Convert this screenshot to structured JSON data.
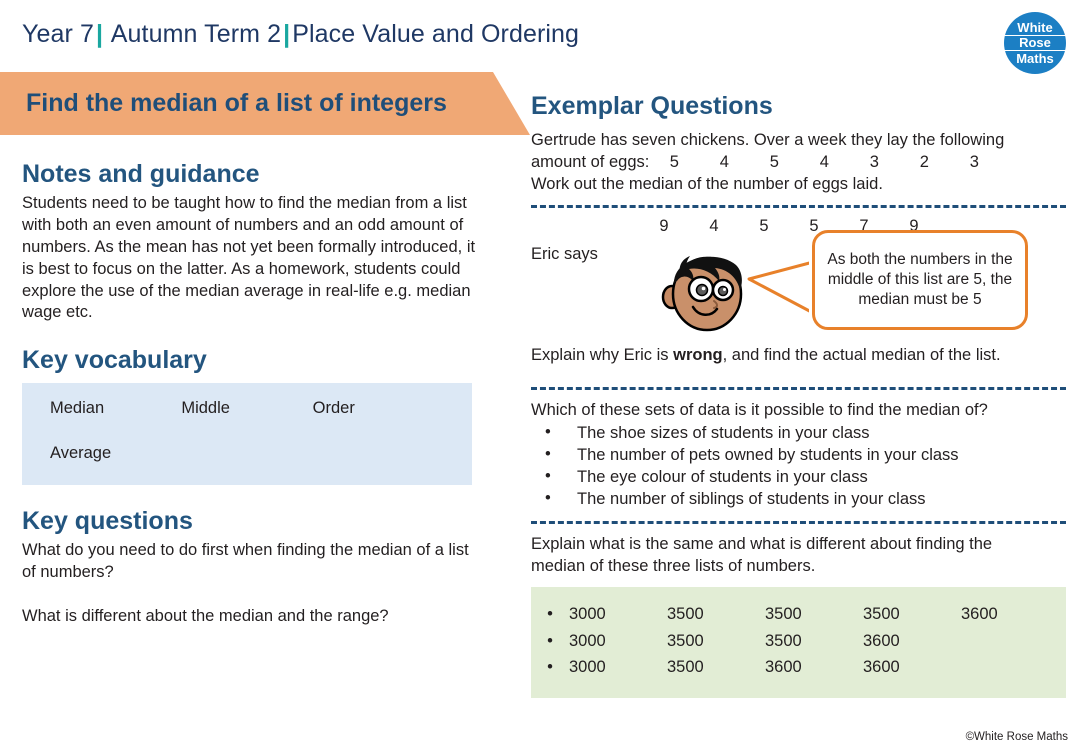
{
  "header": {
    "year": "Year 7",
    "term": "Autumn Term  2",
    "topic": "Place Value and Ordering",
    "separator": "|"
  },
  "logo": {
    "line1": "White",
    "line2": "Rose",
    "line3": "Maths",
    "color": "#1c7fc4"
  },
  "title_banner": {
    "text": "Find the median of a list of integers",
    "background": "#f0a875",
    "text_color": "#1f4e79"
  },
  "left": {
    "notes_heading": "Notes and guidance",
    "notes_text": "Students need to be taught how to find the median from a list with both an even amount of numbers and an odd amount of numbers.  As the mean has not yet been formally introduced, it is best to focus on the latter.  As a homework, students could explore the use of the median average  in real-life e.g. median wage etc.",
    "vocab_heading": "Key vocabulary",
    "vocab_rows": [
      [
        "Median",
        "Middle",
        "Order"
      ],
      [
        "Average",
        "",
        ""
      ]
    ],
    "vocab_background": "#dce8f5",
    "questions_heading": "Key questions",
    "question_1": "What do you need to do first when finding the median of a list of numbers?",
    "question_2": "What is different about the median and the range?"
  },
  "right": {
    "heading": "Exemplar Questions",
    "q1": {
      "line1": "Gertrude has seven chickens.  Over a week they lay the following",
      "line2_label": "amount of eggs:",
      "numbers": [
        "5",
        "4",
        "5",
        "4",
        "3",
        "2",
        "3"
      ],
      "line3": "Work out the median of the number of eggs laid."
    },
    "q2": {
      "numbers": [
        "9",
        "4",
        "5",
        "5",
        "7",
        "9"
      ],
      "says_label": "Eric says",
      "bubble_text": "As both the numbers in the middle of this list are 5, the median must be 5",
      "explain_before": "Explain why Eric is ",
      "explain_bold": "wrong",
      "explain_after": ", and find the actual median of the list.",
      "bubble_border_color": "#e8812a"
    },
    "q3": {
      "prompt": "Which of these sets of data is it possible to find the median of?",
      "items": [
        "The shoe sizes of students in your class",
        "The number of pets owned by students in your class",
        "The eye colour of students in your class",
        "The number of siblings of students in your class"
      ]
    },
    "q4": {
      "prompt_line1": "Explain what is the same and what is different about finding the",
      "prompt_line2": "median of these three lists of numbers.",
      "bullet": "•",
      "background": "#e2edd5",
      "lists": [
        [
          "3000",
          "3500",
          "3500",
          "3500",
          "3600"
        ],
        [
          "3000",
          "3500",
          "3500",
          "3600"
        ],
        [
          "3000",
          "3500",
          "3600",
          "3600"
        ]
      ]
    }
  },
  "footer": {
    "copyright": "©White Rose Maths"
  }
}
